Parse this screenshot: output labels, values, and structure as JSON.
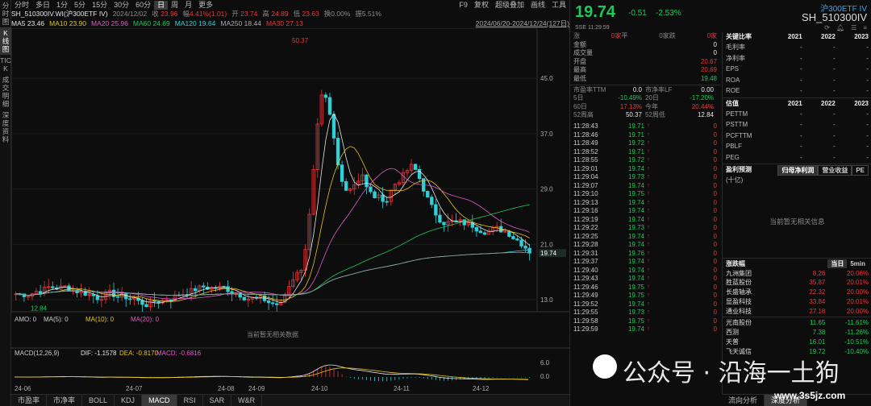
{
  "rail": [
    "分时图",
    "K线图",
    "TICK",
    "成交明细",
    "深度资料"
  ],
  "periods": [
    "分时",
    "多日",
    "1分",
    "5分",
    "15分",
    "30分",
    "60分",
    "日",
    "周",
    "月",
    "更多"
  ],
  "period_active": "日",
  "period_right": [
    "F9",
    "复权",
    "超级叠加",
    "画线",
    "工具"
  ],
  "info": {
    "code": "SH_510300IV.WI(沪300ETF IV)",
    "date": "2024/12/02",
    "open_label": "收",
    "close": "23.96",
    "chg_label": "幅",
    "chg": "4.41%(1.01)",
    "o_label": "开",
    "o": "23.74",
    "h_label": "高",
    "h": "24.89",
    "l_label": "低",
    "l": "23.63",
    "turn": "换0.00%",
    "amp": "振5.51%"
  },
  "ma": [
    {
      "label": "MA5",
      "val": "23.46",
      "color": "#e6e6e6"
    },
    {
      "label": "MA10",
      "val": "23.90",
      "color": "#e8c21c"
    },
    {
      "label": "MA20",
      "val": "25.96",
      "color": "#e05acb"
    },
    {
      "label": "MA60",
      "val": "24.69",
      "color": "#1ec85a"
    },
    {
      "label": "MA120",
      "val": "19.64",
      "color": "#2fd0d8"
    },
    {
      "label": "MA250",
      "val": "18.44",
      "color": "#aaaaaa"
    },
    {
      "label": "MA30",
      "val": "27.13",
      "color": "#e8363b"
    }
  ],
  "range": "2024/06/20-2024/12/24(127日)",
  "price_axis": [
    "45.0",
    "37.0",
    "29.0",
    "21.0",
    "13.0"
  ],
  "last_price_tag": "19.74",
  "high_mark": "50.37",
  "low_mark": "12.84",
  "amo": {
    "title": "AMO: 0",
    "ma5": "MA(5): 0",
    "ma10": "MA(10): 0",
    "ma20": "MA(20): 0",
    "empty": "当前暂无相关数据"
  },
  "macd": {
    "title": "MACD(12,26,9)",
    "dif": "DIF: -1.1578",
    "dea": "DEA: -0.8170",
    "macd": "MACD: -0.6816",
    "axis": [
      "6.0",
      "0.0"
    ]
  },
  "dates": [
    "24-06",
    "24-07",
    "24-08",
    "24-09",
    "24-10",
    "24-11",
    "24-12"
  ],
  "bottom_tabs": [
    "市盈率",
    "市净率",
    "BOLL",
    "KDJ",
    "MACD",
    "RSI",
    "SAR",
    "W&R"
  ],
  "bottom_active": "MACD",
  "quote": {
    "price": "19.74",
    "chg": "-0.51",
    "pct": "-2.53%",
    "name": "沪300ETF IV",
    "code": "SH_510300IV",
    "sub": "SSE  11:29:59"
  },
  "quote_rows": [
    {
      "k": "涨",
      "v": "0家",
      "k2": "平",
      "v2": "0家",
      "k3": "跌",
      "v3": "0家"
    },
    {
      "k": "金额",
      "v": "0"
    },
    {
      "k": "成交量",
      "v": "0"
    },
    {
      "k": "开盘",
      "v": "20.67",
      "c": "red"
    },
    {
      "k": "最高",
      "v": "20.69",
      "c": "red"
    },
    {
      "k": "最低",
      "v": "19.48",
      "c": "green"
    }
  ],
  "quote_rows4": [
    [
      "市盈率TTM",
      "0.0",
      "市净率LF",
      "0.00"
    ],
    [
      "5日",
      "-10.49%",
      "20日",
      "-17.20%"
    ],
    [
      "60日",
      "17.13%",
      "今年",
      "20.44%"
    ],
    [
      "52周高",
      "50.37",
      "52周低",
      "12.84"
    ]
  ],
  "ticks": [
    {
      "t": "11:28:43",
      "p": "19.71",
      "v": "0"
    },
    {
      "t": "11:28:46",
      "p": "19.71",
      "v": "0"
    },
    {
      "t": "11:28:49",
      "p": "19.72",
      "v": "0"
    },
    {
      "t": "11:28:52",
      "p": "19.71",
      "v": "0"
    },
    {
      "t": "11:28:55",
      "p": "19.72",
      "v": "0"
    },
    {
      "t": "11:29:01",
      "p": "19.74",
      "v": "0"
    },
    {
      "t": "11:29:04",
      "p": "19.73",
      "v": "0"
    },
    {
      "t": "11:29:07",
      "p": "19.74",
      "v": "0"
    },
    {
      "t": "11:29:10",
      "p": "19.75",
      "v": "0"
    },
    {
      "t": "11:29:13",
      "p": "19.74",
      "v": "0"
    },
    {
      "t": "11:29:16",
      "p": "19.74",
      "v": "0"
    },
    {
      "t": "11:29:19",
      "p": "19.74",
      "v": "0"
    },
    {
      "t": "11:29:22",
      "p": "19.73",
      "v": "0"
    },
    {
      "t": "11:29:25",
      "p": "19.74",
      "v": "0"
    },
    {
      "t": "11:29:28",
      "p": "19.74",
      "v": "0"
    },
    {
      "t": "11:29:31",
      "p": "19.76",
      "v": "0"
    },
    {
      "t": "11:29:37",
      "p": "19.74",
      "v": "0"
    },
    {
      "t": "11:29:40",
      "p": "19.74",
      "v": "0"
    },
    {
      "t": "11:29:43",
      "p": "19.74",
      "v": "0"
    },
    {
      "t": "11:29:46",
      "p": "19.75",
      "v": "0"
    },
    {
      "t": "11:29:49",
      "p": "19.75",
      "v": "0"
    },
    {
      "t": "11:29:52",
      "p": "19.74",
      "v": "0"
    },
    {
      "t": "11:29:55",
      "p": "19.73",
      "v": "0"
    },
    {
      "t": "11:29:58",
      "p": "19.75",
      "v": "0"
    },
    {
      "t": "11:29:59",
      "p": "19.74",
      "v": "0"
    }
  ],
  "fin": {
    "title1": "关键比率",
    "years": [
      "2021",
      "2022",
      "2023"
    ],
    "rows1": [
      [
        "毛利率",
        "-",
        "-",
        "-"
      ],
      [
        "净利率",
        "-",
        "-",
        "-"
      ],
      [
        "EPS",
        "-",
        "-",
        "-"
      ],
      [
        "ROA",
        "-",
        "-",
        "-"
      ],
      [
        "ROE",
        "-",
        "-",
        "-"
      ]
    ],
    "title2": "估值",
    "rows2": [
      [
        "PETTM",
        "-",
        "-",
        "-"
      ],
      [
        "PSTTM",
        "-",
        "-",
        "-"
      ],
      [
        "PCFTTM",
        "-",
        "-",
        "-"
      ],
      [
        "PBLF",
        "-",
        "-",
        "-"
      ],
      [
        "PEG",
        "-",
        "-",
        "-"
      ]
    ],
    "title3": "盈利预测",
    "unit": "(十亿)",
    "tabs": [
      "归母净利润",
      "营业收益",
      "PE"
    ],
    "empty": "当前暂无相关信息",
    "title4": "涨跌幅",
    "tabs4": [
      "当日",
      "5min"
    ],
    "gainers": [
      [
        "九洲集团",
        "8.26",
        "20.06%"
      ],
      [
        "胜蓝股份",
        "35.87",
        "20.01%"
      ],
      [
        "长盛轴承",
        "22.32",
        "20.00%"
      ],
      [
        "显盈科技",
        "33.84",
        "20.01%"
      ],
      [
        "通业科技",
        "27.18",
        "20.00%"
      ]
    ],
    "losers": [
      [
        "光南股份",
        "11.65",
        "-11.61%"
      ],
      [
        "西测",
        "7.38",
        "-11.26%"
      ],
      [
        "天普",
        "16.01",
        "-10.51%"
      ],
      [
        "飞天诚信",
        "19.72",
        "-10.40%"
      ]
    ],
    "bottom": [
      "流向分析",
      "深度分析"
    ]
  },
  "watermark": "公众号 · 沿海一土狗",
  "site": "www.3s5jz.com",
  "chart_data": {
    "type": "candlestick",
    "range": "2024/06/20-2024/12/24",
    "ylim": [
      13,
      50.37
    ],
    "yticks": [
      13,
      21,
      29,
      37,
      45
    ],
    "phases": [
      {
        "from": "24-06",
        "to": "24-09",
        "level": [
          13,
          15
        ]
      },
      {
        "to": "24-10",
        "level": [
          20,
          50.37
        ]
      },
      {
        "to": "24-12",
        "level": [
          22,
          32
        ]
      },
      {
        "end": 19.74
      }
    ]
  }
}
